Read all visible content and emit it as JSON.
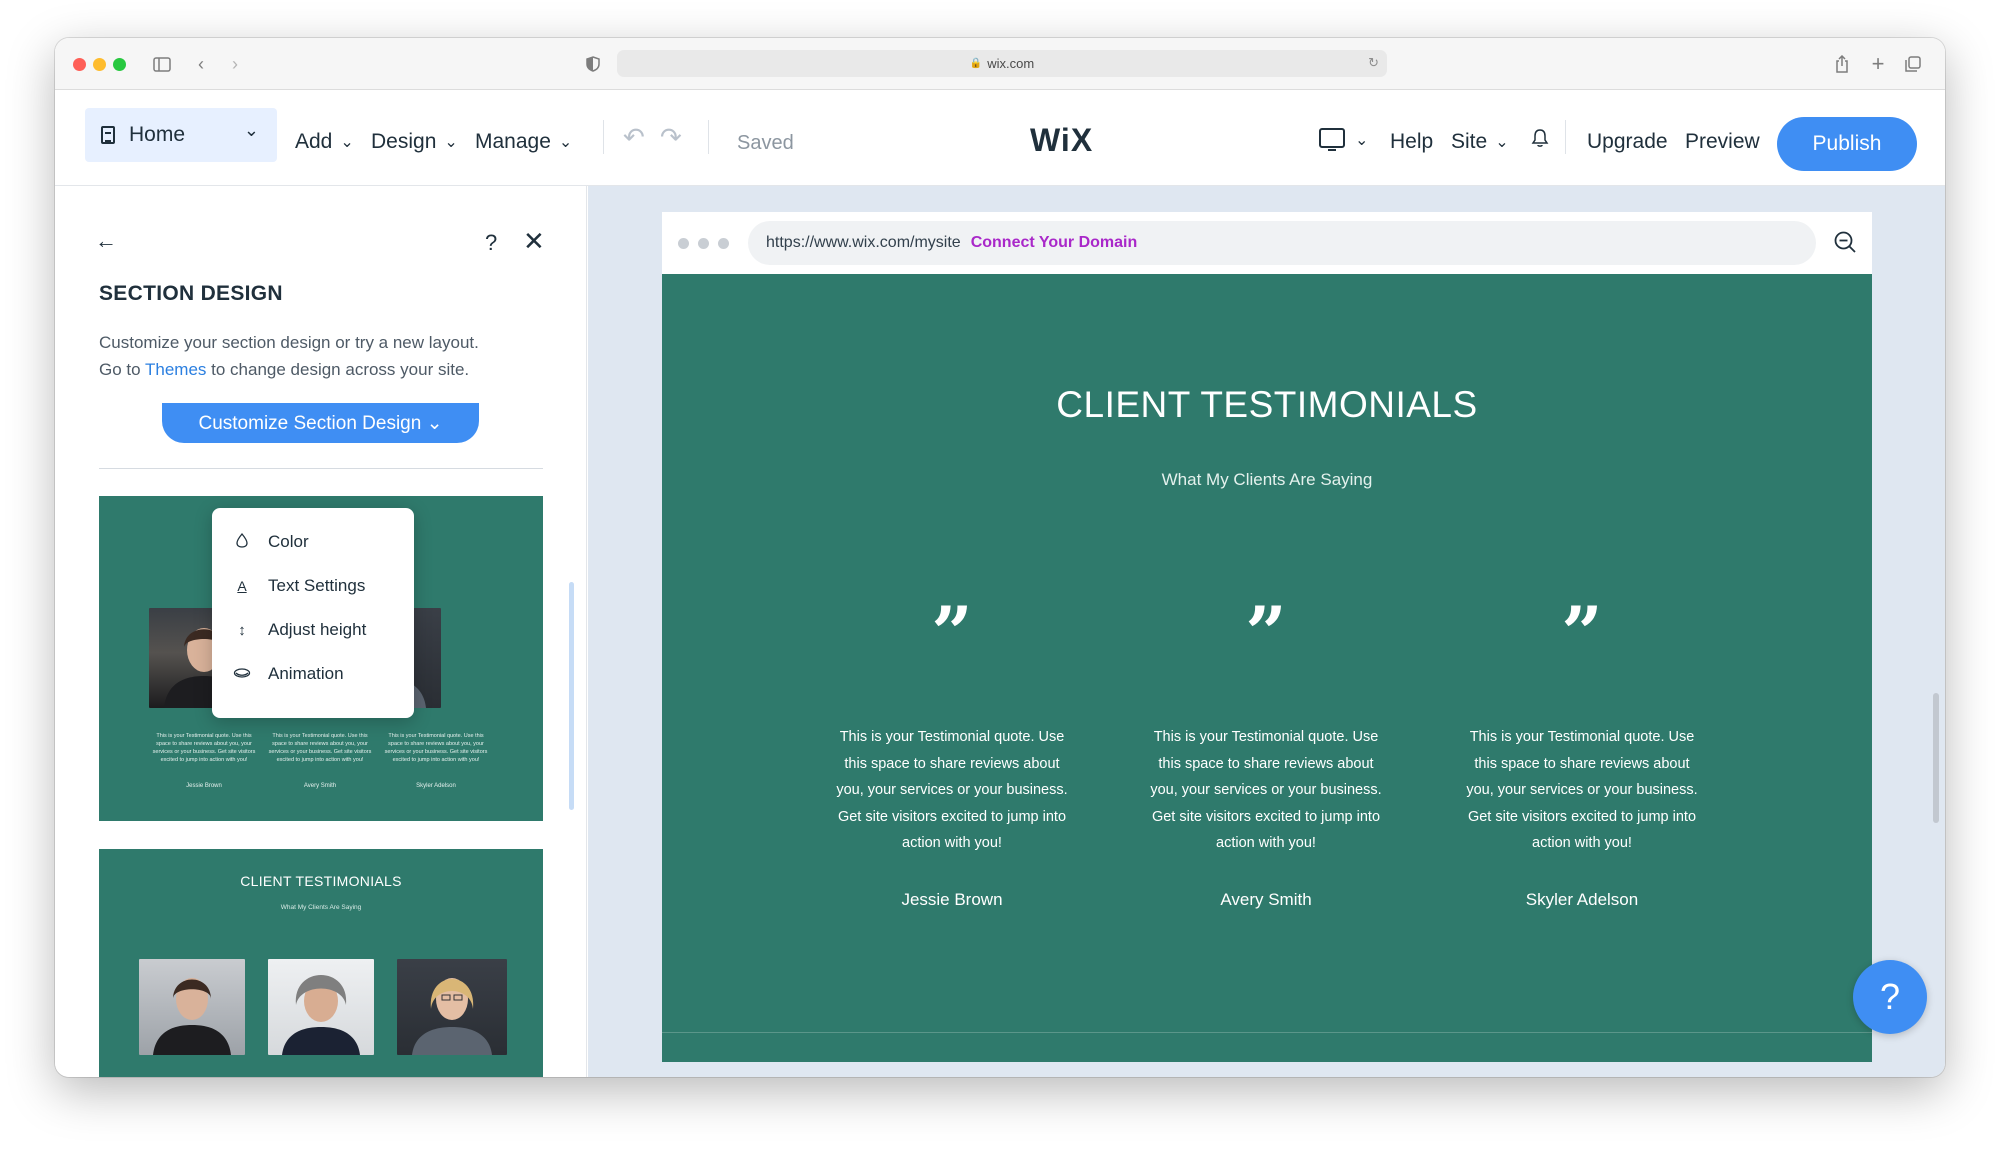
{
  "browser": {
    "url": "wix.com"
  },
  "topbar": {
    "page_select": "Home",
    "menu": [
      "Add",
      "Design",
      "Manage"
    ],
    "status": "Saved",
    "logo": "WiX",
    "help": "Help",
    "site": "Site",
    "upgrade": "Upgrade",
    "preview": "Preview",
    "publish": "Publish"
  },
  "panel": {
    "title": "SECTION DESIGN",
    "desc_line1": "Customize your section design or try a new layout.",
    "desc_go_to": "Go to ",
    "desc_link": "Themes",
    "desc_rest": " to change design across your site.",
    "customize_button": "Customize Section Design ⌄",
    "help": "?",
    "dropdown": [
      "Color",
      "Text Settings",
      "Adjust height",
      "Animation"
    ],
    "card1": {
      "quote": "This is your Testimonial quote. Use this space to share reviews about you, your services or your business. Get site visitors excited to jump into action with you!",
      "names": [
        "Jessie Brown",
        "Avery Smith",
        "Skyler Adelson"
      ]
    },
    "card2": {
      "title": "CLIENT TESTIMONIALS",
      "subtitle": "What My Clients Are Saying"
    }
  },
  "site": {
    "url": "https://www.wix.com/mysite",
    "connect_domain": "Connect Your Domain",
    "title": "CLIENT TESTIMONIALS",
    "subtitle": "What My Clients Are Saying",
    "quote_mark": "”",
    "testimonials": [
      {
        "quote": "This is your Testimonial quote. Use this space to share reviews about you, your services or your business. Get site visitors excited to jump into action with you!",
        "name": "Jessie Brown"
      },
      {
        "quote": "This is your Testimonial quote. Use this space to share reviews about you, your services or your business. Get site visitors excited to jump into action with you!",
        "name": "Avery Smith"
      },
      {
        "quote": "This is your Testimonial quote. Use this space to share reviews about you, your services or your business. Get site visitors excited to jump into action with you!",
        "name": "Skyler Adelson"
      }
    ]
  },
  "help_bubble": "?",
  "colors": {
    "wix_blue": "#3f8ef3",
    "section_green": "#2f7a6c",
    "connect_purple": "#a928c9"
  }
}
